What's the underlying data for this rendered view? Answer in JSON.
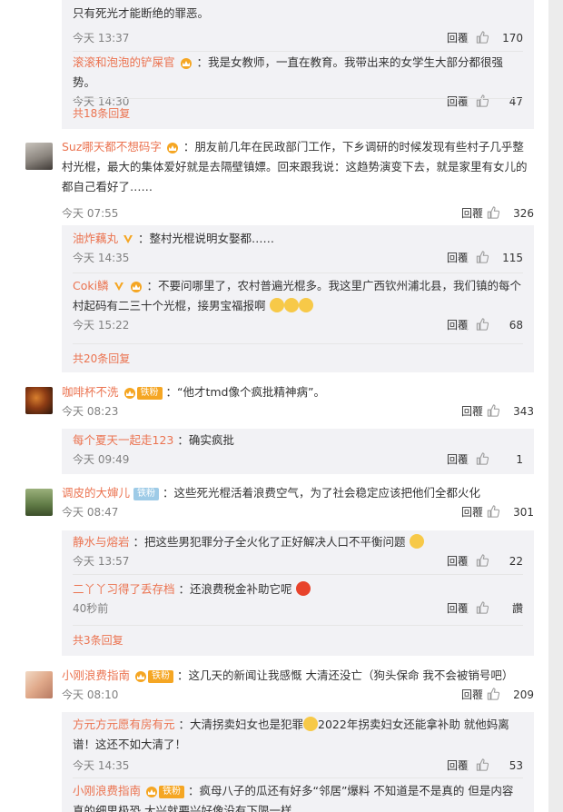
{
  "ui": {
    "reply_label": "回覆",
    "like_label": "讚"
  },
  "thread0": {
    "sub0": {
      "text": "只有死光才能断绝的罪恶。",
      "time": "今天 13:37",
      "likes": "170"
    },
    "sub1": {
      "user": "滚滚和泡泡的铲屎官",
      "text": "：我是女教师，一直在教育。我带出来的女学生大部分都很强势。",
      "time": "今天 14:30",
      "likes": "47"
    },
    "more": "共18条回复"
  },
  "c1": {
    "user": "Suz哪天都不想码字",
    "text": "：朋友前几年在民政部门工作，下乡调研的时候发现有些村子几乎整村光棍，最大的集体爱好就是去隔壁镇嫖。回来跟我说：这趋势演变下去，就是家里有女儿的都自己看好了……",
    "time": "今天 07:55",
    "likes": "326",
    "sub0": {
      "user": "油炸藕丸",
      "text": "：整村光棍说明女娶都……",
      "time": "今天 14:35",
      "likes": "115"
    },
    "sub1": {
      "user": "Coki鳞",
      "text": "：不要问哪里了，农村普遍光棍多。我这里广西钦州浦北县，我们镇的每个村起码有二三十个光棍，接男宝福报啊",
      "time": "今天 15:22",
      "likes": "68"
    },
    "more": "共20条回复"
  },
  "c2": {
    "user": "咖啡杯不洗",
    "badge": "铁粉",
    "text": "：“他才tmd像个疯批精神病”。",
    "time": "今天 08:23",
    "likes": "343",
    "sub0": {
      "user": "每个夏天一起走123",
      "text": "：确实疯批",
      "time": "今天 09:49",
      "likes": "1"
    }
  },
  "c3": {
    "user": "调皮的大婶儿",
    "badge": "铁粉",
    "text": "：这些死光棍活着浪费空气，为了社会稳定应该把他们全都火化",
    "time": "今天 08:47",
    "likes": "301",
    "sub0": {
      "user": "静水与熔岩",
      "text": "：把这些男犯罪分子全火化了正好解决人口不平衡问题",
      "time": "今天 13:57",
      "likes": "22"
    },
    "sub1": {
      "user": "二丫丫习得了丢存档",
      "text": "：还浪费税金补助它呢",
      "time": "40秒前",
      "likes": "讚"
    },
    "more": "共3条回复"
  },
  "c4": {
    "user": "小刚浪费指南",
    "badge": "铁粉",
    "text": "：这几天的新闻让我感慨 大清还没亡（狗头保命 我不会被销号吧）",
    "time": "今天 08:10",
    "likes": "209",
    "sub0": {
      "user": "方元方元愿有房有元",
      "text": "：大清拐卖妇女也是犯罪",
      "text2": "2022年拐卖妇女还能拿补助 就他妈离谱！这还不如大清了！",
      "time": "今天 14:35",
      "likes": "53"
    },
    "sub1": {
      "user": "小刚浪费指南",
      "badge": "铁粉",
      "text": "：疯母八子的瓜还有好多“邻居”爆料 不知道是不是真的 但是内容真的细思极恐 大兴就要兴好像没有下限一样"
    }
  },
  "colors": {
    "link": "#eb7350",
    "sub_bg": "#f2f2f5",
    "text": "#333333",
    "meta": "#808080",
    "vip_badge": "#f5a623",
    "tiefan": "#9ecbe7"
  }
}
